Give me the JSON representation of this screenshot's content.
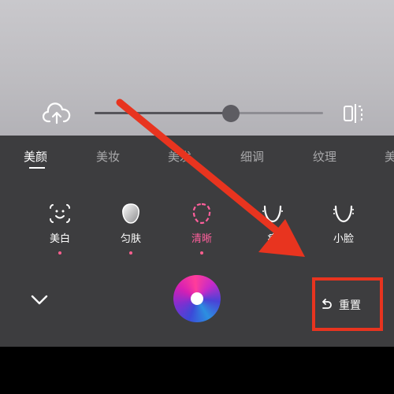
{
  "tabs": [
    "美颜",
    "美妆",
    "美发",
    "细调",
    "纹理",
    "美"
  ],
  "active_tab": "美颜",
  "slider": {
    "level": 0.6
  },
  "features": [
    {
      "label": "美白",
      "icon": "smile-face-icon",
      "selected": false,
      "has_dot": true
    },
    {
      "label": "匀肤",
      "icon": "smooth-skin-icon",
      "selected": false,
      "has_dot": true
    },
    {
      "label": "清晰",
      "icon": "clarity-icon",
      "selected": true,
      "has_dot": true
    },
    {
      "label": "瘦",
      "icon": "face-contour-icon",
      "selected": false,
      "has_dot": false
    },
    {
      "label": "小脸",
      "icon": "small-face-icon",
      "selected": false,
      "has_dot": false
    }
  ],
  "reset_label": "重置",
  "colors": {
    "accent_pink": "#ff5f9c",
    "annotation_red": "#e8341f",
    "panel_bg": "#3d3d3f"
  }
}
